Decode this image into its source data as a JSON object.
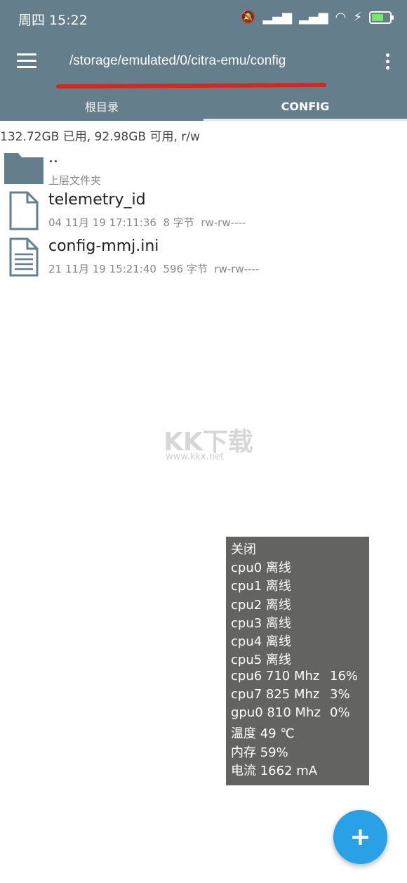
{
  "status_bar": {
    "time": "周四 15:22",
    "icons": [
      "bell-off-icon",
      "signal-icon",
      "signal-icon",
      "wifi-icon",
      "charging-icon",
      "battery-icon"
    ]
  },
  "toolbar": {
    "path": "/storage/emulated/0/citra-emu/config",
    "menu_icon": "hamburger-menu-icon",
    "more_icon": "vertical-dots-icon"
  },
  "tabs": [
    {
      "label": "根目录",
      "active": false
    },
    {
      "label": "CONFIG",
      "active": true
    }
  ],
  "storage_info": "132.72GB 已用, 92.98GB 可用, r/w",
  "files": [
    {
      "name": "..",
      "meta": "上层文件夹",
      "icon": "folder-icon"
    },
    {
      "name": "telemetry_id",
      "meta": "04 11月 19 17:11:36  8 字节  rw-rw----",
      "icon": "file-icon"
    },
    {
      "name": "config-mmj.ini",
      "meta": "21 11月 19 15:21:40  596 字节  rw-rw----",
      "icon": "text-file-icon"
    }
  ],
  "watermark": {
    "text": "KK下载",
    "url": "www.kkx.net"
  },
  "monitor": {
    "lines": [
      {
        "label": "关闭",
        "value": ""
      },
      {
        "label": "cpu0 离线",
        "value": ""
      },
      {
        "label": "cpu1 离线",
        "value": ""
      },
      {
        "label": "cpu2 离线",
        "value": ""
      },
      {
        "label": "cpu3 离线",
        "value": ""
      },
      {
        "label": "cpu4 离线",
        "value": ""
      },
      {
        "label": "cpu5 离线",
        "value": ""
      },
      {
        "label": "cpu6 710 Mhz",
        "value": "16%"
      },
      {
        "label": "cpu7 825 Mhz",
        "value": "3%"
      },
      {
        "label": "gpu0 810 Mhz",
        "value": "0%"
      },
      {
        "label": "温度 49 ℃",
        "value": ""
      },
      {
        "label": "内存 59%",
        "value": ""
      },
      {
        "label": "电流 1662 mA",
        "value": ""
      }
    ]
  },
  "fab": {
    "icon": "plus-icon",
    "symbol": "+"
  },
  "colors": {
    "toolbar": "#647f8b",
    "underline": "#d9271e",
    "fab": "#2aa0e6",
    "monitor_bg": "#636461"
  }
}
